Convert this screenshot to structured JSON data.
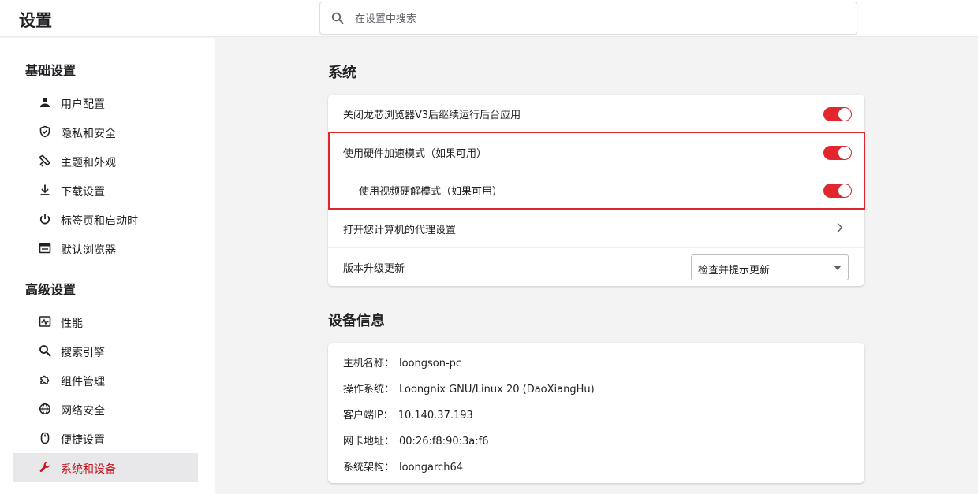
{
  "app": {
    "title": "设置"
  },
  "search": {
    "placeholder": "在设置中搜索"
  },
  "sidebar": {
    "basic_title": "基础设置",
    "advanced_title": "高级设置",
    "basic_items": [
      {
        "label": "用户配置",
        "icon": "person-icon"
      },
      {
        "label": "隐私和安全",
        "icon": "shield-icon"
      },
      {
        "label": "主题和外观",
        "icon": "palette-icon"
      },
      {
        "label": "下载设置",
        "icon": "download-icon"
      },
      {
        "label": "标签页和启动时",
        "icon": "power-icon"
      },
      {
        "label": "默认浏览器",
        "icon": "browser-icon"
      }
    ],
    "advanced_items": [
      {
        "label": "性能",
        "icon": "performance-icon"
      },
      {
        "label": "搜索引擎",
        "icon": "search-icon"
      },
      {
        "label": "组件管理",
        "icon": "puzzle-icon"
      },
      {
        "label": "网络安全",
        "icon": "globe-icon"
      },
      {
        "label": "便捷设置",
        "icon": "mouse-icon"
      },
      {
        "label": "系统和设备",
        "icon": "wrench-icon",
        "active": true
      }
    ]
  },
  "system": {
    "heading": "系统",
    "rows": [
      {
        "label": "关闭龙芯浏览器V3后继续运行后台应用",
        "toggle": true
      },
      {
        "label": "使用硬件加速模式（如果可用）",
        "toggle": true
      },
      {
        "label": "使用视频硬解模式（如果可用）",
        "toggle": true
      },
      {
        "label": "打开您计算机的代理设置"
      },
      {
        "label": "版本升级更新",
        "select_value": "检查并提示更新"
      }
    ]
  },
  "device": {
    "heading": "设备信息",
    "rows": [
      {
        "key": "主机名称：",
        "value": "loongson-pc"
      },
      {
        "key": "操作系统：",
        "value": "Loongnix GNU/Linux 20 (DaoXiangHu)"
      },
      {
        "key": "客户端IP：",
        "value": "10.140.37.193"
      },
      {
        "key": "网卡地址：",
        "value": "00:26:f8:90:3a:f6"
      },
      {
        "key": "系统架构：",
        "value": "loongarch64"
      }
    ]
  },
  "colors": {
    "accent": "#e3262e",
    "active_text": "#c4181f",
    "highlight_border": "#e0262d"
  }
}
